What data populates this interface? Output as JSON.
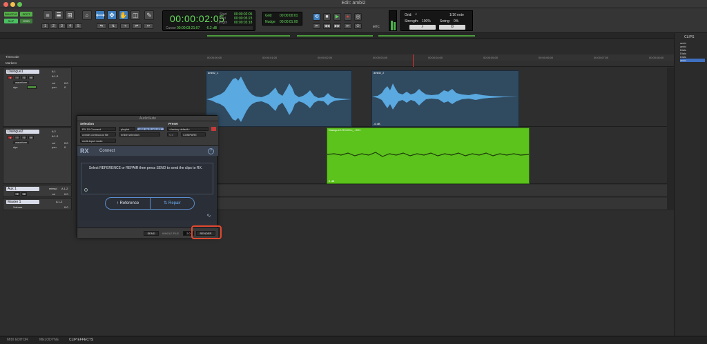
{
  "window": {
    "title": "Edit: ambi2"
  },
  "toolbar": {
    "modes": [
      "SHUFFLE",
      "SPOT",
      "SLIP",
      "GRID"
    ],
    "zoom_presets": [
      "1",
      "2",
      "3",
      "4",
      "5"
    ],
    "counter": {
      "main": "00:00:02:05",
      "start_label": "Start",
      "start_value": "00:00:02:05",
      "end_label": "End",
      "end_value": "00:00:05:23",
      "length_label": "Length",
      "length_value": "00:00:03:18",
      "cursor_label": "Cursor",
      "cursor_value": "00:00:03:21:07",
      "level": "-6.2 dB"
    },
    "grid": {
      "grid_label": "Grid",
      "grid_value": "00:00:00:01",
      "nudge_label": "Nudge",
      "nudge_value": "00:00:01:00"
    },
    "right": {
      "grid_label": "Grid:",
      "grid_value": "1/16 note",
      "strength_label": "Strength:",
      "strength_value": "100%",
      "swing_label": "Swing:",
      "swing_value": "0%"
    },
    "mtc": "MTC"
  },
  "rulers": {
    "timecode_label": "Timecode",
    "markers_label": "Markers",
    "ticks": [
      "00:00:00:00",
      "00:00:01:00",
      "00:00:02:00",
      "00:00:03:00",
      "00:00:04:00",
      "00:00:05:00",
      "00:00:06:00",
      "00:00:07:00",
      "00:00:08:00"
    ]
  },
  "tracks": [
    {
      "name": "Dialogue1",
      "io_in": "A 1",
      "io_out": "A 1-2",
      "view": "waveform",
      "mode": "dyn",
      "vol_label": "vol",
      "vol_value": "0.0",
      "pan_label": "pan",
      "pan_value": "0"
    },
    {
      "name": "Dialogue2",
      "io_in": "A 2",
      "io_out": "A 1-2",
      "view": "waveform",
      "mode": "dyn",
      "vol_label": "vol",
      "vol_value": "0.0",
      "pan_label": "pan",
      "pan_value": "0"
    },
    {
      "name": "Aux 1",
      "io_in": "reread",
      "io_out": "A 1-2",
      "vol_label": "vol",
      "vol_value": "0.0"
    },
    {
      "name": "Master 1",
      "io_in": "A 1-2",
      "view": "Volume",
      "vol_value": "0.0"
    }
  ],
  "clips": [
    {
      "name": "ambi2_1",
      "gain": ""
    },
    {
      "name": "ambi2_2",
      "gain": "-6 dB"
    },
    {
      "name": "Dialogue2-RX10Co_..9H1",
      "gain": "2 dB"
    }
  ],
  "clips_panel": {
    "title": "CLIPS",
    "items": [
      "ambi",
      "ambi",
      "Dialo",
      "Dialo",
      "Dialo",
      "ambi"
    ]
  },
  "plugin": {
    "title": "AudioSuite",
    "selection_label": "Selection",
    "preset_label": "Preset",
    "plugin_name": "RX 10 Connect",
    "playlist": "playlist",
    "use_in_playlist": "USE IN PLAYLIST",
    "factory_default": "<factory default>",
    "create_file": "create continuous file",
    "entire_selection": "entire selection",
    "compare": "COMPARE",
    "multi_input": "multi-input mode",
    "rx_logo": "RX",
    "rx_title": "Connect",
    "rx_message": "Select REFERENCE or REPAIR then press SEND to send the clips to RX.",
    "reference_button": "Reference",
    "repair_button": "Repair",
    "send_button": "SEND",
    "whole_file": "WHOLE FILE",
    "handle_value": "2.0",
    "render_button": "RENDER",
    "help": "?"
  },
  "bottom_tabs": [
    "MIDI EDITOR",
    "MELODYNE",
    "CLIP EFFECTS"
  ],
  "colors": {
    "accent": "#3f7fbf",
    "clip_green": "#5cc21c",
    "clip_blue": "#304a60",
    "waveform_blue": "#5aa9e0",
    "highlight": "#e2492f"
  }
}
